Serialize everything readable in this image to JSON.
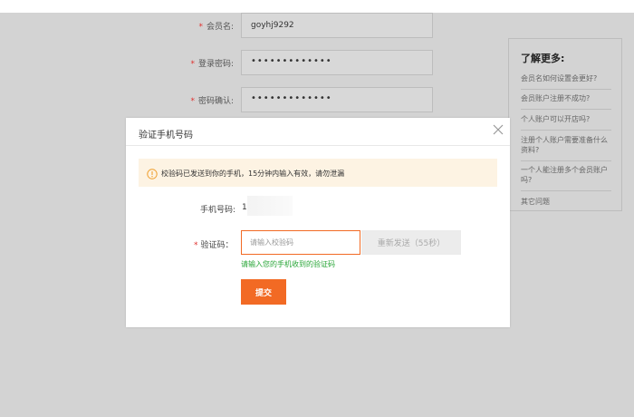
{
  "form": {
    "fields": [
      {
        "label": "会员名:",
        "value": "goyhj9292"
      },
      {
        "label": "登录密码:",
        "value": "•••••••••••••"
      },
      {
        "label": "密码确认:",
        "value": "•••••••••••••"
      }
    ],
    "required_mark": "*"
  },
  "help": {
    "title": "了解更多:",
    "items": [
      "会员名如何设置会更好?",
      "会员账户注册不成功?",
      "个人账户可以开店吗?",
      "注册个人账户需要准备什么资料?",
      "一个人能注册多个会员账户吗?",
      "其它问题"
    ]
  },
  "modal": {
    "title": "验证手机号码",
    "notice": "校验码已发送到你的手机，15分钟内输入有效，请勿泄漏",
    "phone_label": "手机号码:",
    "phone_value": "1",
    "code_label": "验证码：",
    "code_placeholder": "请输入校验码",
    "resend_label": "重新发送（55秒）",
    "hint": "请输入您的手机收到的验证码",
    "submit_label": "提交"
  },
  "colors": {
    "accent": "#f26a24",
    "hint_green": "#27a536",
    "required_red": "#e0312f"
  }
}
